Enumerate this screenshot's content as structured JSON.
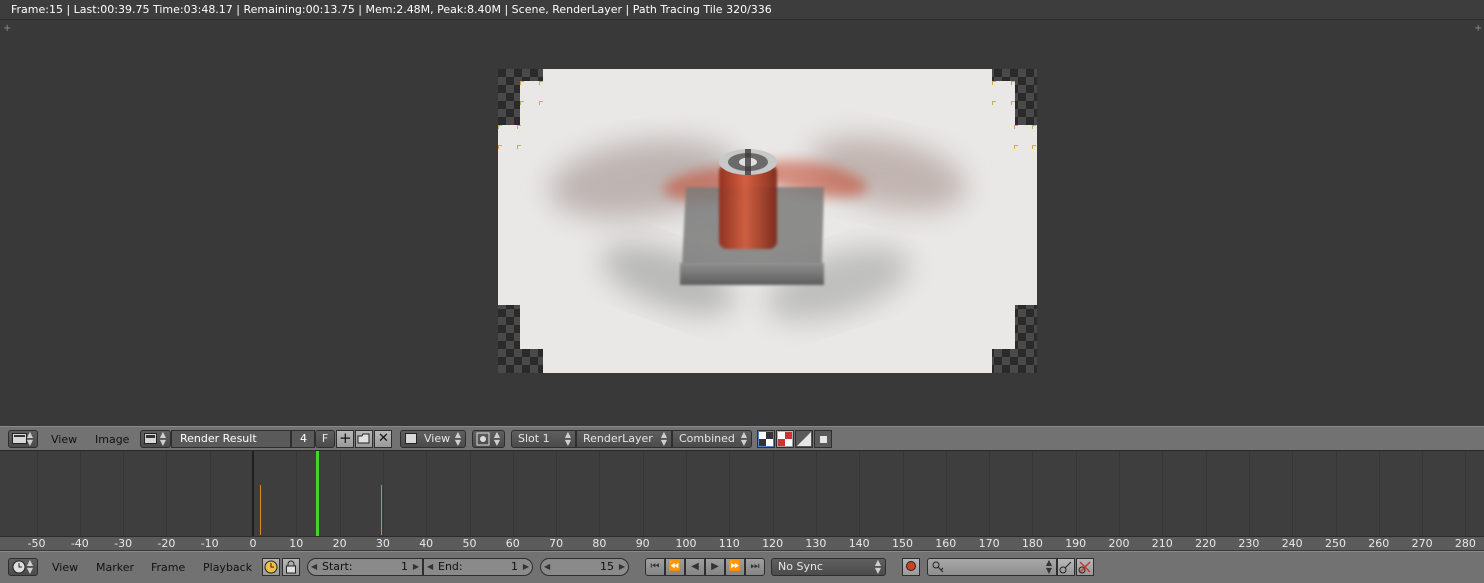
{
  "status": {
    "text": "Frame:15 | Last:00:39.75 Time:03:48.17 | Remaining:00:13.75 | Mem:2.48M, Peak:8.40M | Scene, RenderLayer | Path Tracing Tile 320/336"
  },
  "image_editor_header": {
    "menu_view": "View",
    "menu_image": "Image",
    "image_name": "Render Result",
    "users_count": "4",
    "fake_user": "F",
    "view_mode": "View",
    "slot": "Slot 1",
    "layer": "RenderLayer",
    "pass": "Combined"
  },
  "timeline": {
    "ticks": [
      "-50",
      "-40",
      "-30",
      "-20",
      "-10",
      "0",
      "10",
      "20",
      "30",
      "40",
      "50",
      "60",
      "70",
      "80",
      "90",
      "100",
      "110",
      "120",
      "130",
      "140",
      "150",
      "160",
      "170",
      "180",
      "190",
      "200",
      "210",
      "220",
      "230",
      "240",
      "250",
      "260",
      "270",
      "280"
    ],
    "current_frame": 15,
    "keyframes": [
      2,
      30
    ]
  },
  "timeline_header": {
    "menu_view": "View",
    "menu_marker": "Marker",
    "menu_frame": "Frame",
    "menu_playback": "Playback",
    "start_label": "Start:",
    "start_value": "1",
    "end_label": "End:",
    "end_value": "1",
    "current_value": "15",
    "sync_mode": "No Sync"
  },
  "colors": {
    "current_frame": "#4bd12f",
    "keyframe": "#d88a1e",
    "tile_marker": "#e8a23a"
  }
}
